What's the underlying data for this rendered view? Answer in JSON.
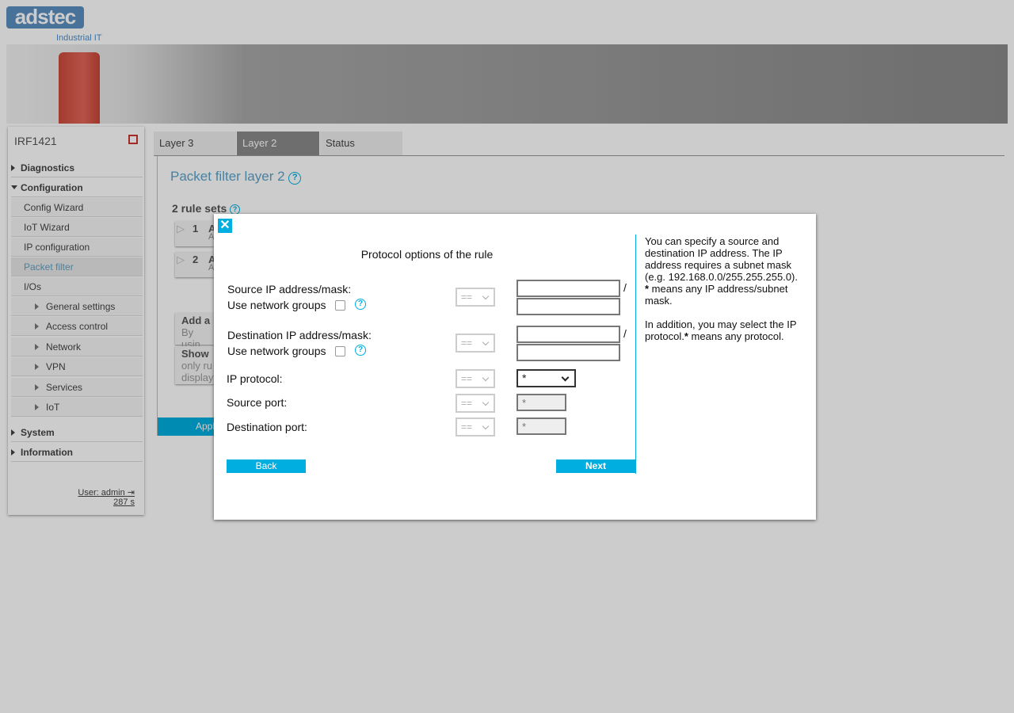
{
  "brand": {
    "logo": "adstec",
    "subtitle": "Industrial IT"
  },
  "sidebar": {
    "device_name": "IRF1421",
    "items": [
      {
        "label": "Diagnostics"
      },
      {
        "label": "Configuration"
      },
      {
        "label": "Config Wizard"
      },
      {
        "label": "IoT Wizard"
      },
      {
        "label": "IP configuration"
      },
      {
        "label": "Packet filter"
      },
      {
        "label": "I/Os"
      },
      {
        "label": "General settings"
      },
      {
        "label": "Access control"
      },
      {
        "label": "Network"
      },
      {
        "label": "VPN"
      },
      {
        "label": "Services"
      },
      {
        "label": "IoT"
      },
      {
        "label": "System"
      },
      {
        "label": "Information"
      }
    ],
    "user": "User: admin",
    "timer": "287 s"
  },
  "tabs": [
    {
      "label": "Layer 3"
    },
    {
      "label": "Layer 2"
    },
    {
      "label": "Status"
    }
  ],
  "main": {
    "title": "Packet filter layer 2",
    "rule_sets_label": "2 rule sets",
    "rules": [
      {
        "num": "1",
        "label": "A",
        "sub": "A"
      },
      {
        "num": "2",
        "label": "A",
        "sub": "A"
      }
    ],
    "add_label": "Add a",
    "add_sub": "By usin",
    "show_label": "Show",
    "show_sub1": "only ru",
    "show_sub2": "display",
    "apply_label": "Appl"
  },
  "modal": {
    "title": "Protocol options of the rule",
    "source_ip_label": "Source IP address/mask:",
    "use_groups_label": "Use network groups",
    "dest_ip_label": "Destination IP address/mask:",
    "ip_protocol_label": "IP protocol:",
    "source_port_label": "Source port:",
    "dest_port_label": "Destination port:",
    "operator": "==",
    "slash": "/",
    "protocol_value": "*",
    "source_port_placeholder": "*",
    "dest_port_placeholder": "*",
    "back_label": "Back",
    "next_label": "Next",
    "help_para1_part1": "You can specify a source and destination IP address. The IP address requires a subnet mask (e.g. 192.168.0.0/255.255.255.0).",
    "help_star": "*",
    "help_para1_part2": " means any IP address/subnet mask.",
    "help_para2_part1": "In addition, you may select the IP protocol.",
    "help_para2_part2": " means any protocol."
  },
  "colors": {
    "accent": "#00aee0",
    "title_blue": "#5aa3c8"
  }
}
